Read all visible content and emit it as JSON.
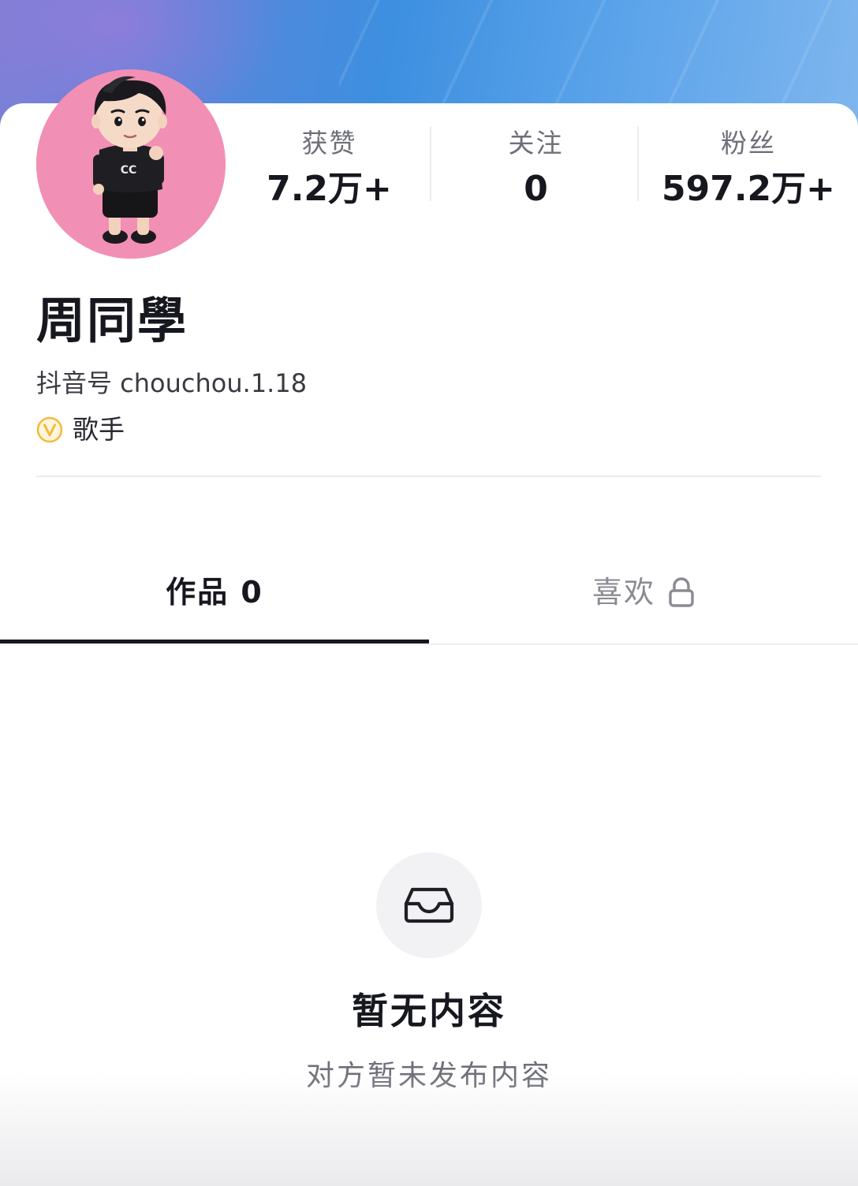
{
  "colors": {
    "accent_dark": "#17181f",
    "avatar_bg": "#f28fb4",
    "badge_yellow": "#f5b93a"
  },
  "stats": [
    {
      "label": "获赞",
      "value": "7.2万+"
    },
    {
      "label": "关注",
      "value": "0"
    },
    {
      "label": "粉丝",
      "value": "597.2万+"
    }
  ],
  "profile": {
    "name": "周同學",
    "douyin_id": "抖音号 chouchou.1.18",
    "tag_icon": "verified-v-icon",
    "tag": "歌手"
  },
  "tabs": [
    {
      "label": "作品 0",
      "active": true
    },
    {
      "label": "喜欢",
      "icon": "lock-icon",
      "active": false
    }
  ],
  "empty_state": {
    "icon": "inbox-icon",
    "title": "暂无内容",
    "subtitle": "对方暂未发布内容"
  }
}
